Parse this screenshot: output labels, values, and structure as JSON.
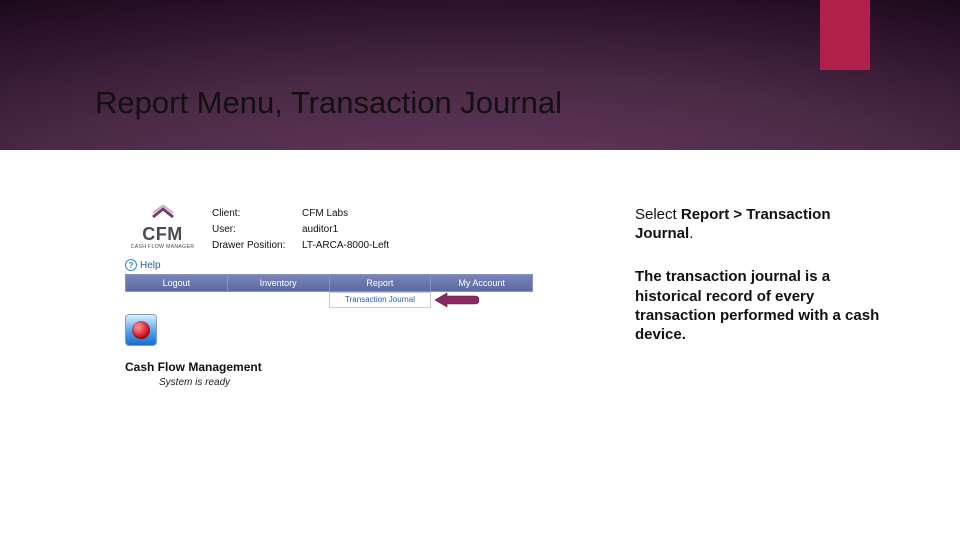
{
  "slide": {
    "title": "Report Menu, Transaction Journal"
  },
  "app": {
    "logo": {
      "main": "CFM",
      "sub": "CASH FLOW MANAGER"
    },
    "info": {
      "client_label": "Client:",
      "client_value": "CFM Labs",
      "user_label": "User:",
      "user_value": "auditor1",
      "drawer_label": "Drawer Position:",
      "drawer_value": "LT-ARCA-8000-Left"
    },
    "help": "Help",
    "nav": {
      "logout": "Logout",
      "inventory": "Inventory",
      "report": "Report",
      "myaccount": "My Account"
    },
    "submenu": {
      "transaction_journal": "Transaction Journal"
    },
    "heading": "Cash Flow Management",
    "status": "System is ready"
  },
  "side": {
    "p1_a": "Select ",
    "p1_b": "Report > Transaction Journal",
    "p1_c": ".",
    "p2": "The transaction journal is a historical record of every transaction performed with a cash device."
  }
}
